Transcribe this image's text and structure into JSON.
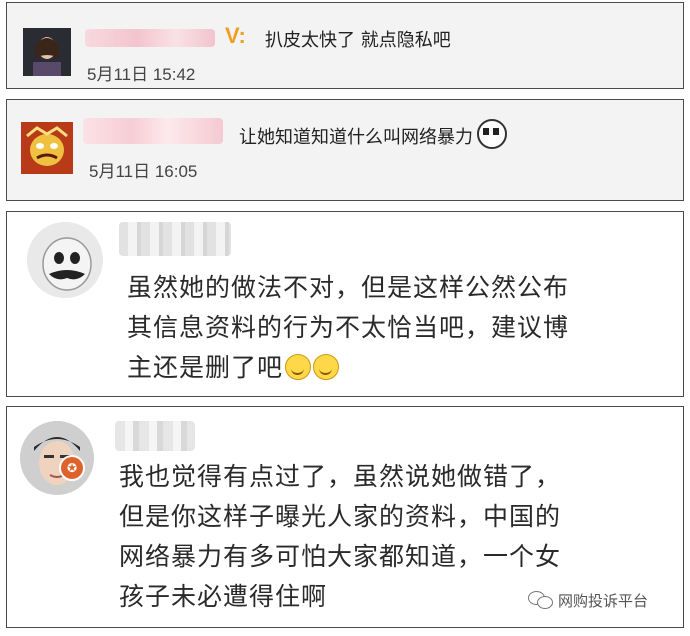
{
  "comments": [
    {
      "text": "扒皮太快了 就点隐私吧",
      "time": "5月11日 15:42",
      "badge": "V:"
    },
    {
      "text": "让她知道知道什么叫网络暴力",
      "time": "5月11日 16:05"
    },
    {
      "lines": [
        "虽然她的做法不对，但是这样公然公布",
        "其信息资料的行为不太恰当吧，建议博",
        "主还是删了吧"
      ]
    },
    {
      "lines": [
        "我也觉得有点过了，虽然说她做错了，",
        "但是你这样子曝光人家的资料，中国的",
        "网络暴力有多可怕大家都知道，一个女",
        "孩子未必遭得住啊"
      ]
    }
  ],
  "watermark": "网购投诉平台",
  "icons": {
    "emoji": "smile-icon",
    "panda": "panda-icon",
    "wechat": "wechat-icon"
  }
}
